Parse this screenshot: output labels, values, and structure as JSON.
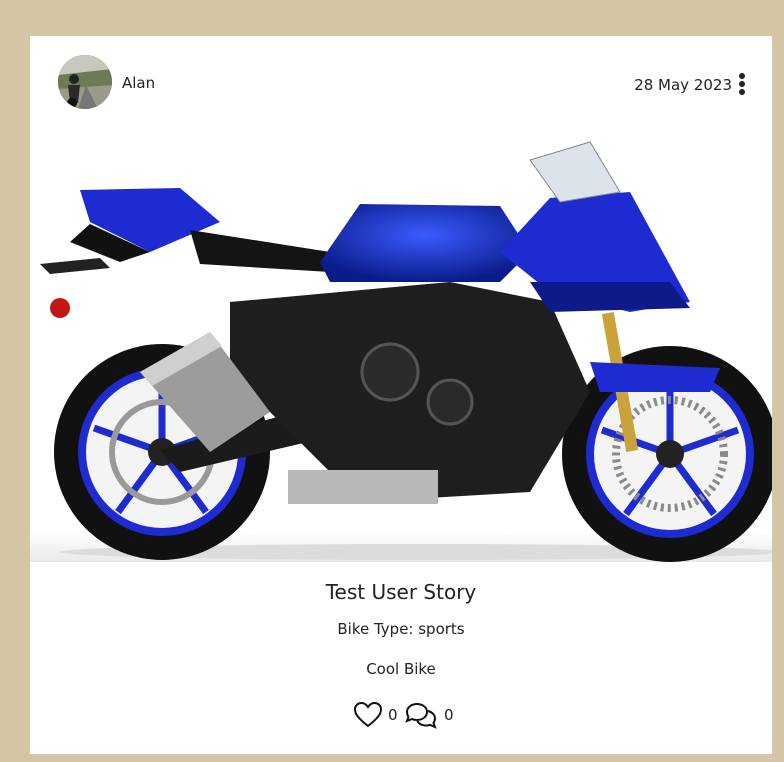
{
  "post": {
    "author": "Alan",
    "date": "28 May 2023",
    "title": "Test User Story",
    "bike_type": "Bike Type: sports",
    "description": "Cool Bike",
    "likes": "0",
    "comments": "0"
  },
  "icons": {
    "more": "more-vertical-icon",
    "like": "heart-icon",
    "comment": "comments-icon"
  },
  "colors": {
    "background": "#d4c6a4",
    "card": "#ffffff",
    "bike_blue": "#1a2fb8"
  }
}
